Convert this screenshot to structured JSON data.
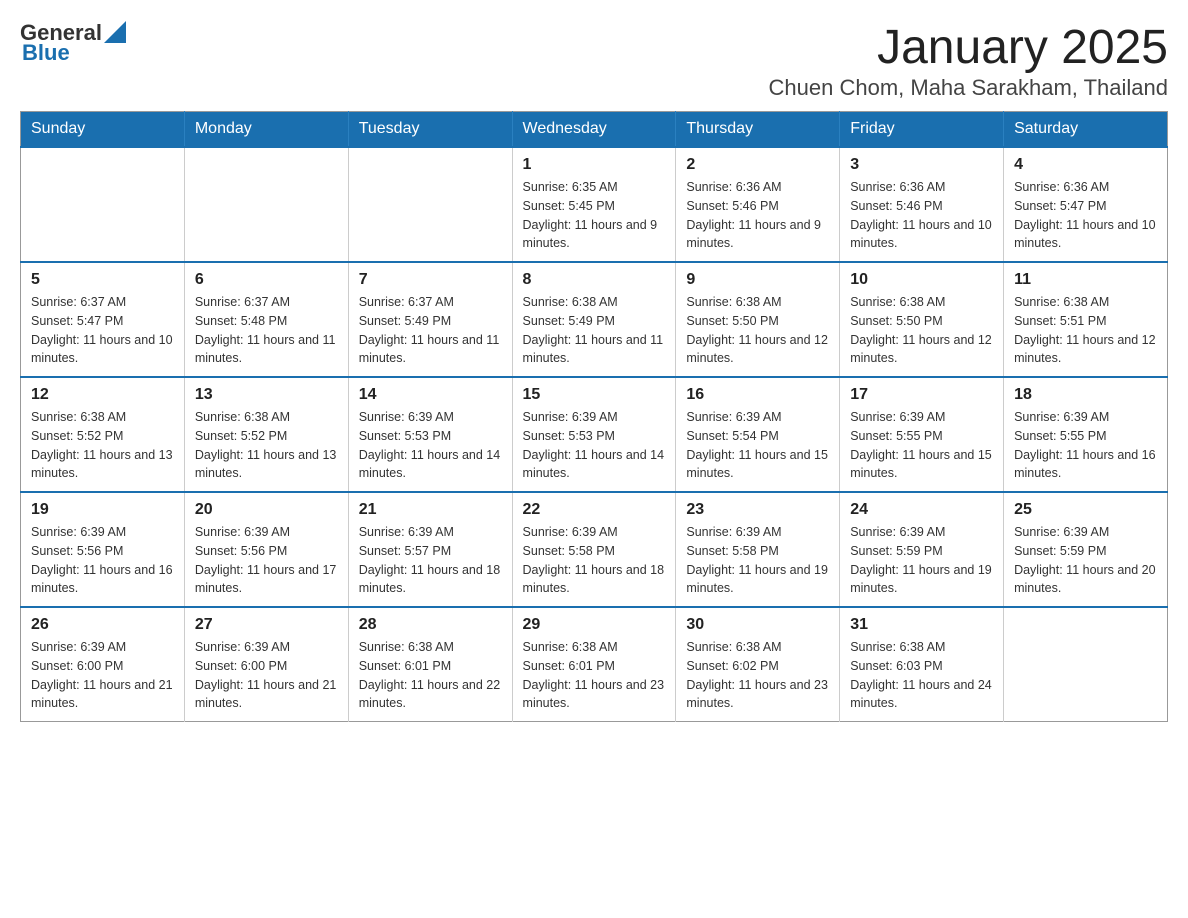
{
  "header": {
    "logo_general": "General",
    "logo_blue": "Blue",
    "title": "January 2025",
    "subtitle": "Chuen Chom, Maha Sarakham, Thailand"
  },
  "calendar": {
    "headers": [
      "Sunday",
      "Monday",
      "Tuesday",
      "Wednesday",
      "Thursday",
      "Friday",
      "Saturday"
    ],
    "weeks": [
      [
        {
          "day": "",
          "info": ""
        },
        {
          "day": "",
          "info": ""
        },
        {
          "day": "",
          "info": ""
        },
        {
          "day": "1",
          "info": "Sunrise: 6:35 AM\nSunset: 5:45 PM\nDaylight: 11 hours and 9 minutes."
        },
        {
          "day": "2",
          "info": "Sunrise: 6:36 AM\nSunset: 5:46 PM\nDaylight: 11 hours and 9 minutes."
        },
        {
          "day": "3",
          "info": "Sunrise: 6:36 AM\nSunset: 5:46 PM\nDaylight: 11 hours and 10 minutes."
        },
        {
          "day": "4",
          "info": "Sunrise: 6:36 AM\nSunset: 5:47 PM\nDaylight: 11 hours and 10 minutes."
        }
      ],
      [
        {
          "day": "5",
          "info": "Sunrise: 6:37 AM\nSunset: 5:47 PM\nDaylight: 11 hours and 10 minutes."
        },
        {
          "day": "6",
          "info": "Sunrise: 6:37 AM\nSunset: 5:48 PM\nDaylight: 11 hours and 11 minutes."
        },
        {
          "day": "7",
          "info": "Sunrise: 6:37 AM\nSunset: 5:49 PM\nDaylight: 11 hours and 11 minutes."
        },
        {
          "day": "8",
          "info": "Sunrise: 6:38 AM\nSunset: 5:49 PM\nDaylight: 11 hours and 11 minutes."
        },
        {
          "day": "9",
          "info": "Sunrise: 6:38 AM\nSunset: 5:50 PM\nDaylight: 11 hours and 12 minutes."
        },
        {
          "day": "10",
          "info": "Sunrise: 6:38 AM\nSunset: 5:50 PM\nDaylight: 11 hours and 12 minutes."
        },
        {
          "day": "11",
          "info": "Sunrise: 6:38 AM\nSunset: 5:51 PM\nDaylight: 11 hours and 12 minutes."
        }
      ],
      [
        {
          "day": "12",
          "info": "Sunrise: 6:38 AM\nSunset: 5:52 PM\nDaylight: 11 hours and 13 minutes."
        },
        {
          "day": "13",
          "info": "Sunrise: 6:38 AM\nSunset: 5:52 PM\nDaylight: 11 hours and 13 minutes."
        },
        {
          "day": "14",
          "info": "Sunrise: 6:39 AM\nSunset: 5:53 PM\nDaylight: 11 hours and 14 minutes."
        },
        {
          "day": "15",
          "info": "Sunrise: 6:39 AM\nSunset: 5:53 PM\nDaylight: 11 hours and 14 minutes."
        },
        {
          "day": "16",
          "info": "Sunrise: 6:39 AM\nSunset: 5:54 PM\nDaylight: 11 hours and 15 minutes."
        },
        {
          "day": "17",
          "info": "Sunrise: 6:39 AM\nSunset: 5:55 PM\nDaylight: 11 hours and 15 minutes."
        },
        {
          "day": "18",
          "info": "Sunrise: 6:39 AM\nSunset: 5:55 PM\nDaylight: 11 hours and 16 minutes."
        }
      ],
      [
        {
          "day": "19",
          "info": "Sunrise: 6:39 AM\nSunset: 5:56 PM\nDaylight: 11 hours and 16 minutes."
        },
        {
          "day": "20",
          "info": "Sunrise: 6:39 AM\nSunset: 5:56 PM\nDaylight: 11 hours and 17 minutes."
        },
        {
          "day": "21",
          "info": "Sunrise: 6:39 AM\nSunset: 5:57 PM\nDaylight: 11 hours and 18 minutes."
        },
        {
          "day": "22",
          "info": "Sunrise: 6:39 AM\nSunset: 5:58 PM\nDaylight: 11 hours and 18 minutes."
        },
        {
          "day": "23",
          "info": "Sunrise: 6:39 AM\nSunset: 5:58 PM\nDaylight: 11 hours and 19 minutes."
        },
        {
          "day": "24",
          "info": "Sunrise: 6:39 AM\nSunset: 5:59 PM\nDaylight: 11 hours and 19 minutes."
        },
        {
          "day": "25",
          "info": "Sunrise: 6:39 AM\nSunset: 5:59 PM\nDaylight: 11 hours and 20 minutes."
        }
      ],
      [
        {
          "day": "26",
          "info": "Sunrise: 6:39 AM\nSunset: 6:00 PM\nDaylight: 11 hours and 21 minutes."
        },
        {
          "day": "27",
          "info": "Sunrise: 6:39 AM\nSunset: 6:00 PM\nDaylight: 11 hours and 21 minutes."
        },
        {
          "day": "28",
          "info": "Sunrise: 6:38 AM\nSunset: 6:01 PM\nDaylight: 11 hours and 22 minutes."
        },
        {
          "day": "29",
          "info": "Sunrise: 6:38 AM\nSunset: 6:01 PM\nDaylight: 11 hours and 23 minutes."
        },
        {
          "day": "30",
          "info": "Sunrise: 6:38 AM\nSunset: 6:02 PM\nDaylight: 11 hours and 23 minutes."
        },
        {
          "day": "31",
          "info": "Sunrise: 6:38 AM\nSunset: 6:03 PM\nDaylight: 11 hours and 24 minutes."
        },
        {
          "day": "",
          "info": ""
        }
      ]
    ]
  }
}
